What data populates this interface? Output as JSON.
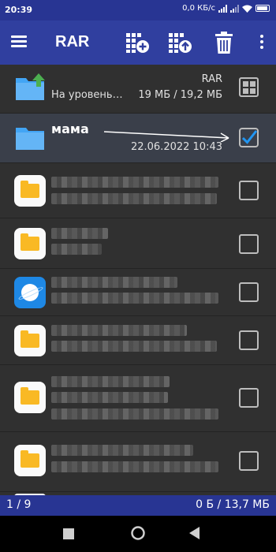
{
  "status": {
    "time": "20:39",
    "speed": "0,0 КБ/с"
  },
  "toolbar": {
    "title": "RAR"
  },
  "list": {
    "up": {
      "name": "На уровень…",
      "archive": "RAR",
      "size": "19 МБ / 19,2 МБ"
    },
    "folder": {
      "name": "мама",
      "date": "22.06.2022 10:43"
    }
  },
  "footer": {
    "position": "1 / 9",
    "selected_size": "0 Б / 13,7 МБ"
  },
  "colors": {
    "statusbar": "#283593",
    "toolbar": "#303f9f",
    "background": "#303030",
    "checkmark": "#2196f3",
    "folder": "#42a5f5",
    "app_folder": "#f9b924",
    "up_arrow": "#4caf50"
  }
}
